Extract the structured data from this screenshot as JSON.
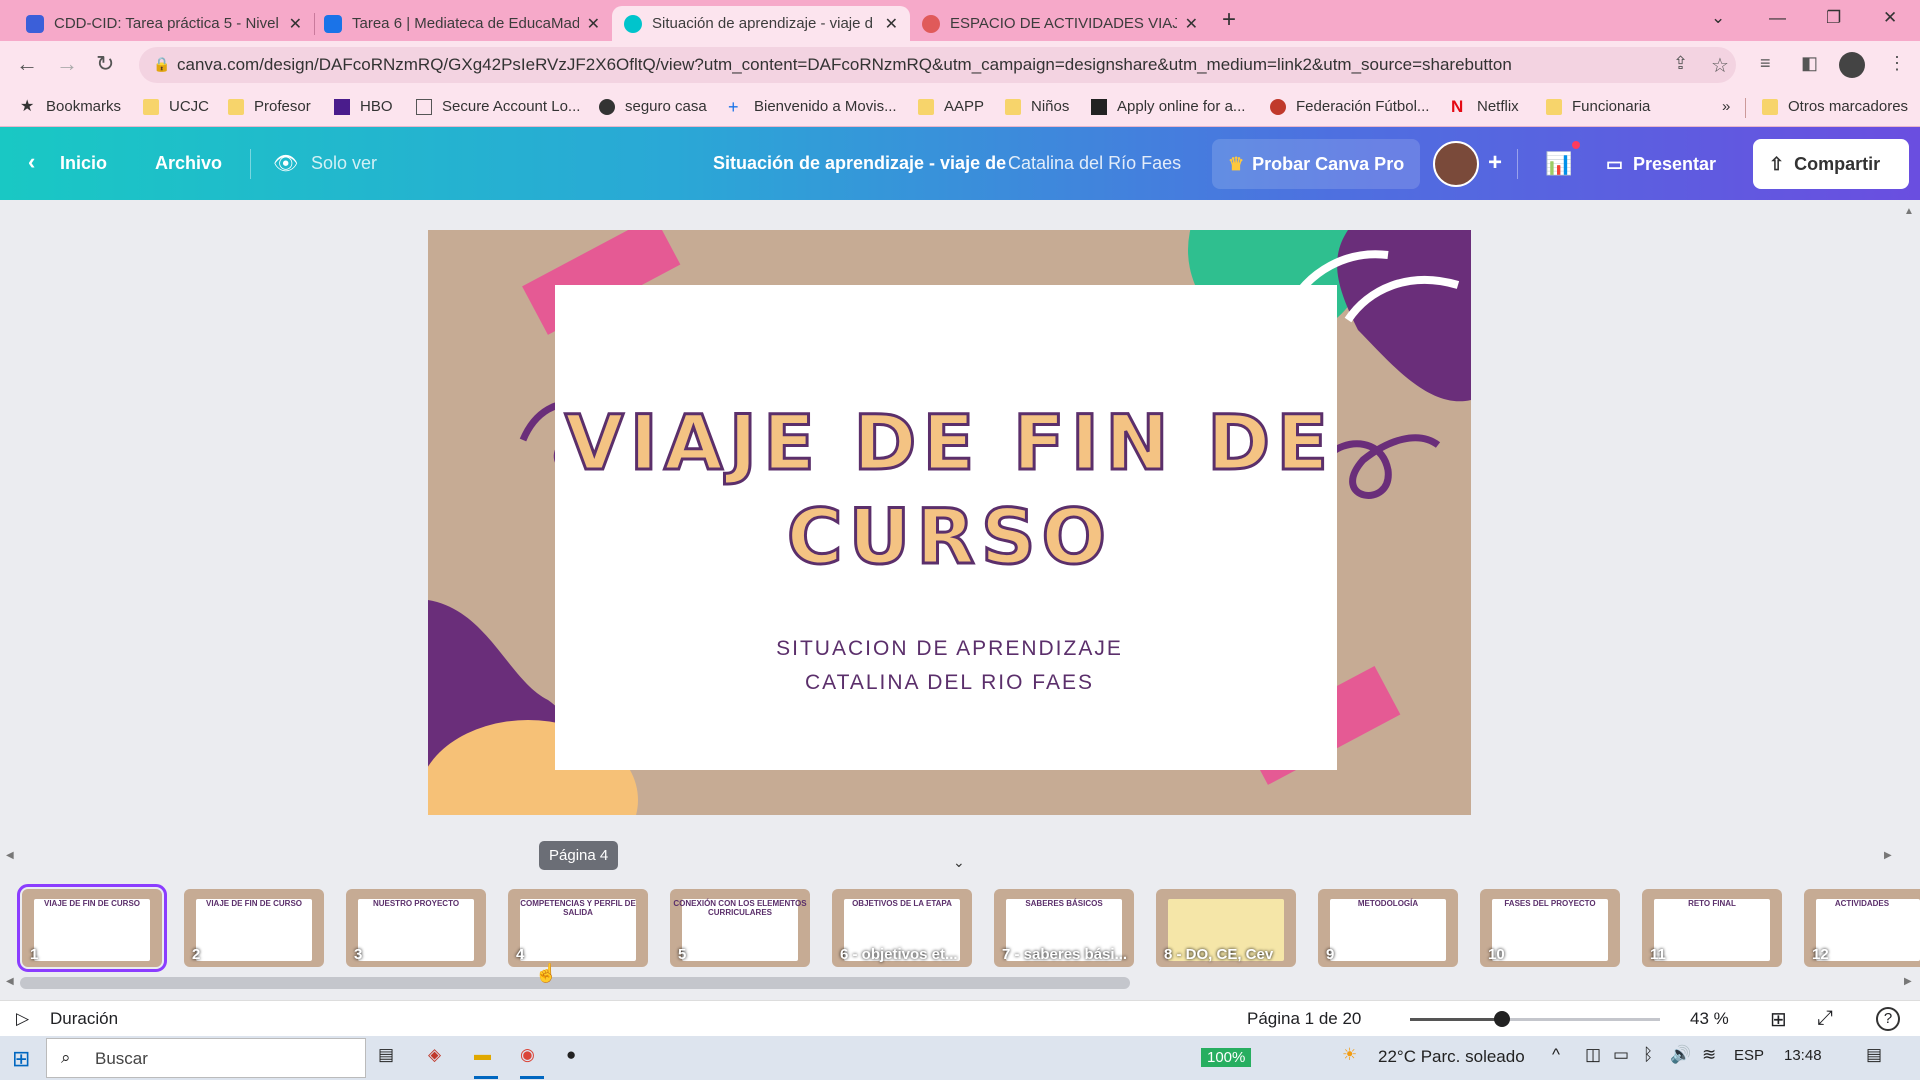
{
  "browser": {
    "tabs": [
      {
        "title": "CDD-CID: Tarea práctica 5 - Nivel",
        "color": "#3b5fd9"
      },
      {
        "title": "Tarea 6 | Mediateca de EducaMad",
        "color": "#1a73e8"
      },
      {
        "title": "Situación de aprendizaje - viaje d",
        "color": "#00c4cc"
      },
      {
        "title": "ESPACIO DE ACTIVIDADES VIAJE",
        "color": "#e05a5a"
      }
    ],
    "new_tab": "+",
    "url": "canva.com/design/DAFcoRNzmRQ/GXg42PsIeRVzJF2X6OfltQ/view?utm_content=DAFcoRNzmRQ&utm_campaign=designshare&utm_medium=link2&utm_source=sharebutton"
  },
  "bookmarks": {
    "items": [
      {
        "label": "Bookmarks",
        "icon": "star-icon"
      },
      {
        "label": "UCJC",
        "icon": "folder-icon"
      },
      {
        "label": "Profesor",
        "icon": "folder-icon"
      },
      {
        "label": "HBO",
        "icon": "hbo-icon"
      },
      {
        "label": "Secure Account Lo...",
        "icon": "page-icon"
      },
      {
        "label": "seguro casa",
        "icon": "globe-icon"
      },
      {
        "label": "Bienvenido a Movis...",
        "icon": "plus-icon"
      },
      {
        "label": "AAPP",
        "icon": "folder-icon"
      },
      {
        "label": "Niños",
        "icon": "folder-icon"
      },
      {
        "label": "Apply online for a...",
        "icon": "building-icon"
      },
      {
        "label": "Federación Fútbol...",
        "icon": "crest-icon"
      },
      {
        "label": "Netflix",
        "icon": "netflix-icon"
      },
      {
        "label": "Funcionaria",
        "icon": "folder-icon"
      }
    ],
    "more": "»",
    "other": "Otros marcadores"
  },
  "canva": {
    "home": "Inicio",
    "file": "Archivo",
    "view_only": "Solo ver",
    "doc_title": "Situación de aprendizaje - viaje de",
    "author": "Catalina del Río Faes",
    "try_pro": "Probar Canva Pro",
    "present": "Presentar",
    "share": "Compartir"
  },
  "slide": {
    "title_line1": "VIAJE DE FIN DE",
    "title_line2": "CURSO",
    "subtitle1": "SITUACION DE APRENDIZAJE",
    "subtitle2": "CATALINA DEL RIO FAES"
  },
  "tooltip": "Página 4",
  "thumbnails": [
    {
      "label": "1",
      "heading": "VIAJE DE FIN DE CURSO"
    },
    {
      "label": "2",
      "heading": "VIAJE DE FIN DE CURSO"
    },
    {
      "label": "3",
      "heading": "NUESTRO PROYECTO"
    },
    {
      "label": "4",
      "heading": "COMPETENCIAS Y PERFIL DE SALIDA"
    },
    {
      "label": "5",
      "heading": "CONEXIÓN CON LOS ELEMENTOS CURRICULARES"
    },
    {
      "label": "6 - objetivos et...",
      "heading": "OBJETIVOS DE LA ETAPA"
    },
    {
      "label": "7 - saberes bási...",
      "heading": "SABERES BÁSICOS"
    },
    {
      "label": "8 - DO, CE, Cev",
      "heading": ""
    },
    {
      "label": "9",
      "heading": "METODOLOGÍA"
    },
    {
      "label": "10",
      "heading": "FASES DEL PROYECTO"
    },
    {
      "label": "11",
      "heading": "RETO FINAL"
    },
    {
      "label": "12",
      "heading": "ACTIVIDADES"
    }
  ],
  "footer": {
    "duration": "Duración",
    "page_info": "Página 1 de 20",
    "zoom": "43 %",
    "zoom_level": 0.43
  },
  "taskbar": {
    "search": "Buscar",
    "battery": "100%",
    "weather": "22°C  Parc. soleado",
    "lang": "ESP",
    "time": "13:48"
  }
}
